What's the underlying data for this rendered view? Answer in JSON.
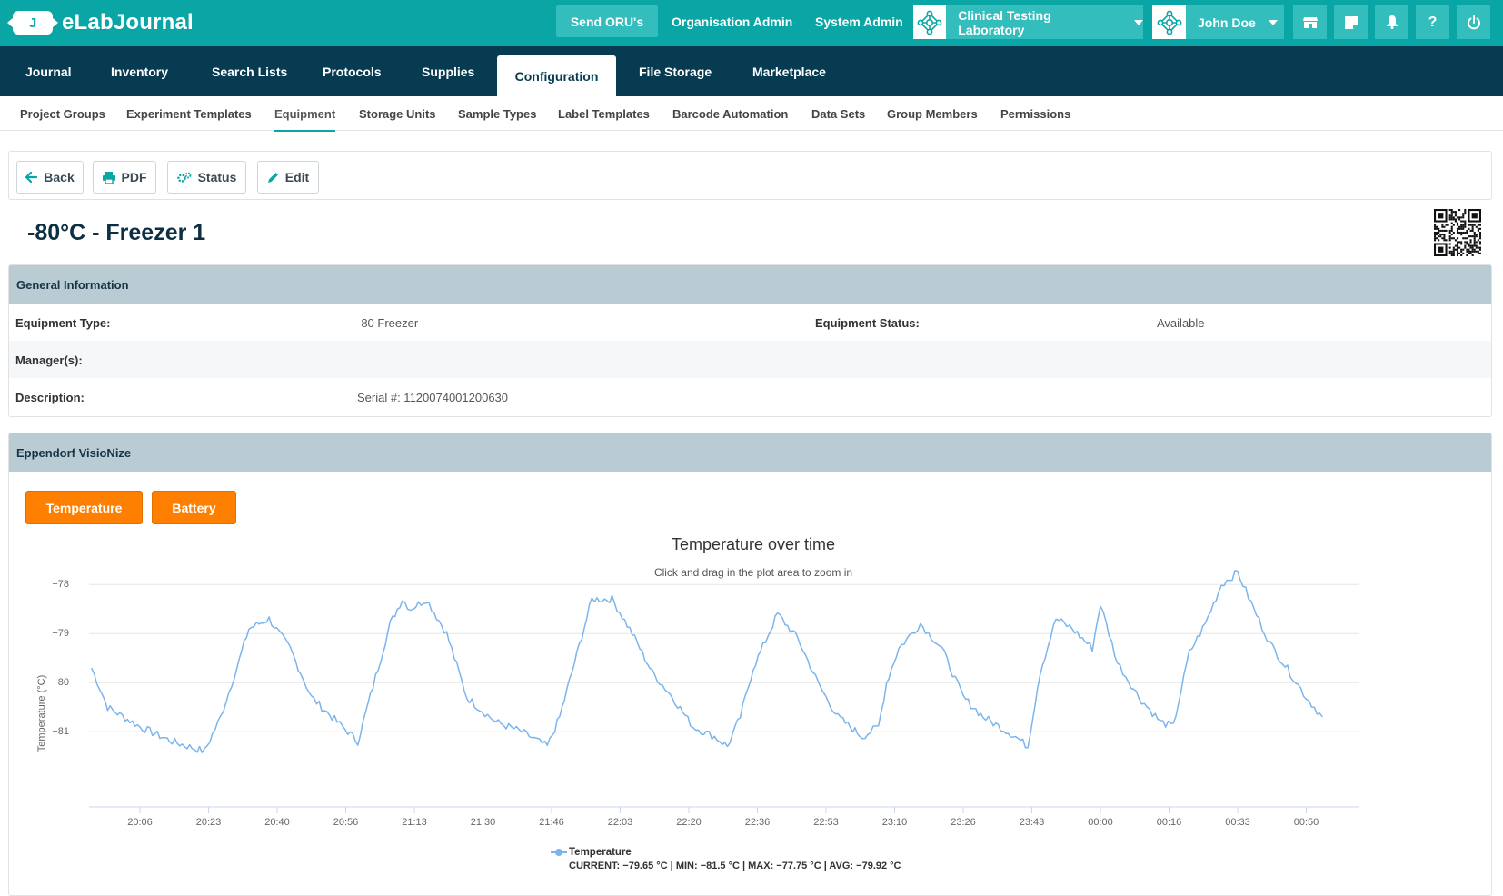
{
  "app": {
    "name": "eLabJournal",
    "logo_letter": "J"
  },
  "topbar": {
    "send_label": "Send ORU's",
    "org_admin": "Organisation Admin",
    "system_admin": "System Admin",
    "lab_name": "Clinical Testing Laboratory",
    "user_name": "John Doe",
    "icons": [
      "store-icon",
      "note-icon",
      "bell-icon",
      "help-icon",
      "power-icon"
    ],
    "help_glyph": "?"
  },
  "mainnav": {
    "items": [
      "Journal",
      "Inventory",
      "Search Lists",
      "Protocols",
      "Supplies",
      "Configuration",
      "File Storage",
      "Marketplace"
    ],
    "active": "Configuration"
  },
  "subnav": {
    "items": [
      "Project Groups",
      "Experiment Templates",
      "Equipment",
      "Storage Units",
      "Sample Types",
      "Label Templates",
      "Barcode Automation",
      "Data Sets",
      "Group Members",
      "Permissions"
    ],
    "active": "Equipment"
  },
  "actions": {
    "back": "Back",
    "pdf": "PDF",
    "status": "Status",
    "edit": "Edit"
  },
  "page": {
    "title": "-80°C - Freezer 1"
  },
  "general": {
    "heading": "General Information",
    "equipment_type_label": "Equipment Type:",
    "equipment_type": "-80 Freezer",
    "equipment_status_label": "Equipment Status:",
    "equipment_status": "Available",
    "managers_label": "Manager(s):",
    "description_label": "Description:",
    "description": "Serial #: 1120074001200630"
  },
  "device": {
    "heading": "Eppendorf VisioNize",
    "temperature_btn": "Temperature",
    "battery_btn": "Battery"
  },
  "colors": {
    "accent": "#0aa6a6",
    "nav": "#073b52",
    "orange": "#ff8000",
    "series": "#7cb5ec",
    "panel_head": "#b9cbd3"
  },
  "chart_data": {
    "type": "line",
    "title": "Temperature over time",
    "subtitle": "Click and drag in the plot area to zoom in",
    "xlabel": "",
    "ylabel": "Temperature (°C)",
    "ylim": [
      -81.7,
      -77.7
    ],
    "yticks": [
      -78,
      -79,
      -80,
      -81
    ],
    "xtick_labels": [
      "20:06",
      "20:23",
      "20:40",
      "20:56",
      "21:13",
      "21:30",
      "21:46",
      "22:03",
      "22:20",
      "22:36",
      "22:53",
      "23:10",
      "23:26",
      "23:43",
      "00:00",
      "00:16",
      "00:33",
      "00:50"
    ],
    "grid": true,
    "legend_position": "bottom-center",
    "series": [
      {
        "name": "Temperature",
        "legend_stats": "CURRENT: −79.65 °C | MIN: −81.5 °C | MAX: −77.75 °C | AVG: −79.92 °C",
        "x": [
          "19:54",
          "19:58",
          "20:06",
          "20:14",
          "20:22",
          "20:26",
          "20:30",
          "20:33",
          "20:38",
          "20:43",
          "20:48",
          "20:54",
          "20:59",
          "21:04",
          "21:07",
          "21:10",
          "21:12",
          "21:16",
          "21:21",
          "21:26",
          "21:33",
          "21:39",
          "21:45",
          "21:48",
          "21:51",
          "21:56",
          "22:01",
          "22:06",
          "22:11",
          "22:16",
          "22:21",
          "22:26",
          "22:29",
          "22:32",
          "22:35",
          "22:41",
          "22:46",
          "22:51",
          "22:53",
          "22:56",
          "23:02",
          "23:06",
          "23:08",
          "23:11",
          "23:16",
          "23:21",
          "23:26",
          "23:31",
          "23:39",
          "23:42",
          "23:45",
          "23:49",
          "23:53",
          "23:58",
          "00:00",
          "00:04",
          "00:09",
          "00:14",
          "00:17",
          "00:21",
          "00:25",
          "00:29",
          "00:33",
          "00:37",
          "00:41",
          "00:46",
          "00:50",
          "00:54"
        ],
        "y": [
          -79.7,
          -80.5,
          -80.9,
          -81.2,
          -81.4,
          -80.7,
          -79.7,
          -78.9,
          -78.7,
          -79.3,
          -80.3,
          -80.8,
          -81.2,
          -79.7,
          -78.8,
          -78.3,
          -78.5,
          -78.3,
          -79.0,
          -80.3,
          -80.8,
          -81.0,
          -81.3,
          -80.7,
          -79.8,
          -78.3,
          -78.3,
          -79.0,
          -79.8,
          -80.3,
          -80.9,
          -81.1,
          -81.3,
          -80.7,
          -79.7,
          -78.6,
          -79.1,
          -80.0,
          -80.3,
          -80.7,
          -81.1,
          -80.9,
          -80.0,
          -79.3,
          -78.8,
          -79.3,
          -80.3,
          -80.7,
          -81.1,
          -81.3,
          -79.8,
          -78.7,
          -78.9,
          -79.3,
          -78.4,
          -79.6,
          -80.3,
          -80.8,
          -80.9,
          -79.4,
          -78.8,
          -78.0,
          -77.75,
          -78.5,
          -79.2,
          -79.8,
          -80.3,
          -80.7
        ]
      }
    ]
  }
}
